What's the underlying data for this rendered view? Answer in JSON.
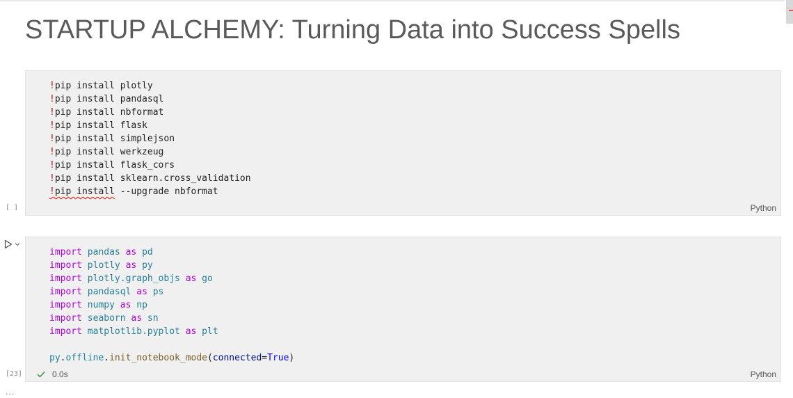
{
  "markdown": {
    "title": "STARTUP ALCHEMY: Turning Data into Success Spells"
  },
  "cell1": {
    "exec_count": "[ ]",
    "language": "Python",
    "lines": [
      {
        "bang": "!",
        "cmd": "pip install",
        "arg": " plotly"
      },
      {
        "bang": "!",
        "cmd": "pip install",
        "arg": " pandasql"
      },
      {
        "bang": "!",
        "cmd": "pip install",
        "arg": " nbformat"
      },
      {
        "bang": "!",
        "cmd": "pip install",
        "arg": " flask"
      },
      {
        "bang": "!",
        "cmd": "pip install",
        "arg": " simplejson"
      },
      {
        "bang": "!",
        "cmd": "pip install",
        "arg": " werkzeug"
      },
      {
        "bang": "!",
        "cmd": "pip install",
        "arg": " flask_cors"
      },
      {
        "bang": "!",
        "cmd": "pip install",
        "arg": " sklearn.cross_validation"
      },
      {
        "bang": "!",
        "cmd": "pip install",
        "arg": " --upgrade nbformat"
      }
    ]
  },
  "cell2": {
    "exec_count": "[23]",
    "language": "Python",
    "status_time": "0.0s",
    "imports": [
      {
        "kw1": "import",
        "mod": "pandas",
        "kw2": "as",
        "alias": "pd"
      },
      {
        "kw1": "import",
        "mod": "plotly",
        "kw2": "as",
        "alias": "py"
      },
      {
        "kw1": "import",
        "mod": "plotly.graph_objs",
        "kw2": "as",
        "alias": "go"
      },
      {
        "kw1": "import",
        "mod": "pandasql",
        "kw2": "as",
        "alias": "ps"
      },
      {
        "kw1": "import",
        "mod": "numpy",
        "kw2": "as",
        "alias": "np"
      },
      {
        "kw1": "import",
        "mod": "seaborn",
        "kw2": "as",
        "alias": "sn"
      },
      {
        "kw1": "import",
        "mod": "matplotlib.pyplot",
        "kw2": "as",
        "alias": "plt"
      }
    ],
    "last_line": {
      "obj": "py",
      "dot1": ".",
      "attr": "offline",
      "dot2": ".",
      "func": "init_notebook_mode",
      "open": "(",
      "param": "connected",
      "eq": "=",
      "value": "True",
      "close": ")"
    }
  },
  "more_indicator": "...",
  "icons": {
    "run": "run-cell-icon",
    "expand": "chevron-down-icon",
    "success": "checkmark-icon"
  }
}
